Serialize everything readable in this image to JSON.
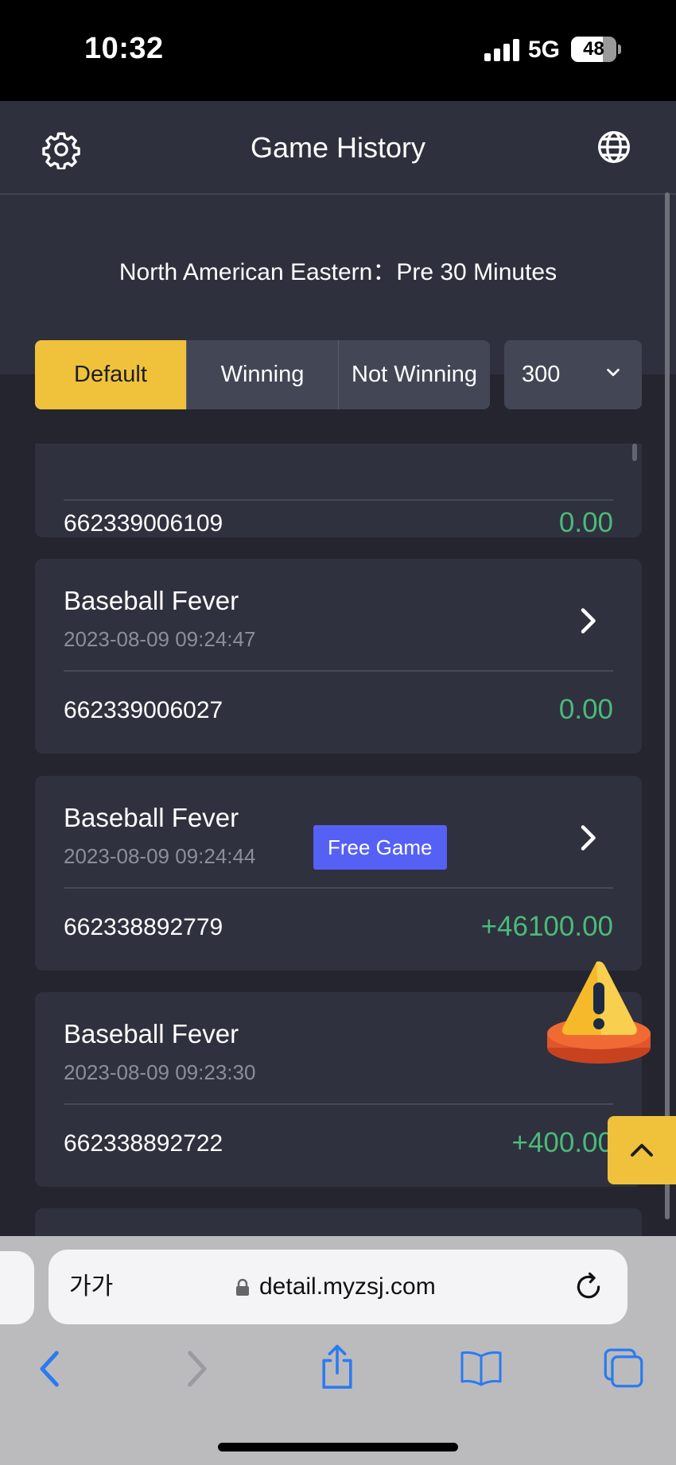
{
  "status_bar": {
    "time": "10:32",
    "network": "5G",
    "battery": "48"
  },
  "header": {
    "title": "Game History",
    "settings_icon": "gear-icon",
    "language_icon": "globe-icon"
  },
  "info": {
    "timezone_text": "North American Eastern：Pre 30 Minutes"
  },
  "filters": {
    "tabs": [
      {
        "label": "Default",
        "active": true
      },
      {
        "label": "Winning",
        "active": false
      },
      {
        "label": "Not Winning",
        "active": false
      }
    ],
    "count_select": {
      "value": "300"
    }
  },
  "records": [
    {
      "round_id": "662339006109",
      "amount": "0.00"
    },
    {
      "game": "Baseball Fever",
      "datetime": "2023-08-09 09:24:47",
      "round_id": "662339006027",
      "amount": "0.00"
    },
    {
      "game": "Baseball Fever",
      "datetime": "2023-08-09 09:24:44",
      "badge": "Free Game",
      "round_id": "662338892779",
      "amount": "+46100.00"
    },
    {
      "game": "Baseball Fever",
      "datetime": "2023-08-09 09:23:30",
      "round_id": "662338892722",
      "amount": "+400.00"
    }
  ],
  "browser": {
    "text_size_label": "가가",
    "url": "detail.myzsj.com"
  },
  "colors": {
    "accent": "#f0c23c",
    "positive": "#4bba7a",
    "badge": "#5561f5",
    "card": "#2f313e",
    "background": "#24252f"
  }
}
